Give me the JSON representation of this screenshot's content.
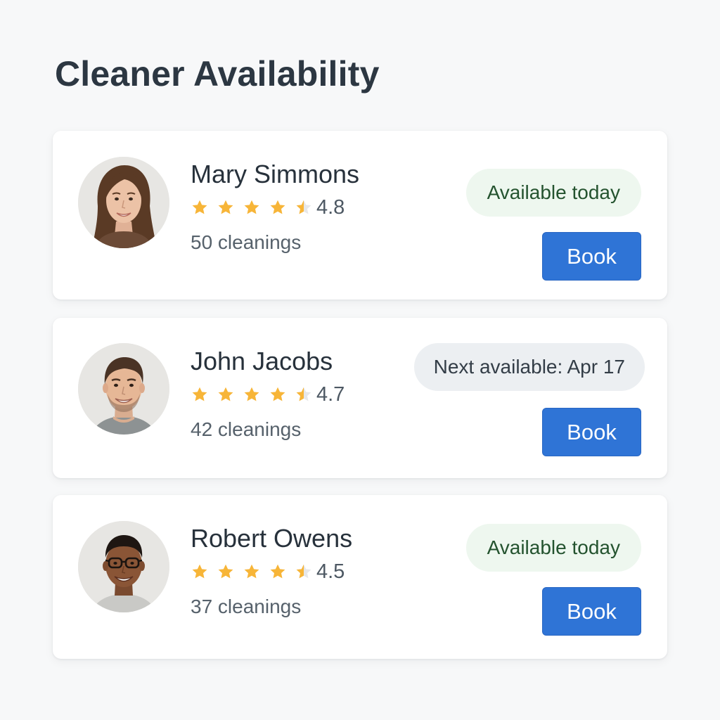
{
  "page": {
    "title": "Cleaner Availability"
  },
  "colors": {
    "star": "#f7b538",
    "star_empty": "#e6e7e9",
    "available_badge_bg": "#eef7ef",
    "available_badge_text": "#24532f",
    "next_badge_bg": "#eceff2",
    "book_button_bg": "#2f74d6"
  },
  "cleaners": [
    {
      "name": "Mary Simmons",
      "rating": "4.8",
      "stars_shown": 4.5,
      "cleanings": "50 cleanings",
      "availability": "Available today",
      "availability_status": "available",
      "book_label": "Book",
      "avatar_icon": "avatar-woman-icon"
    },
    {
      "name": "John Jacobs",
      "rating": "4.7",
      "stars_shown": 4.5,
      "cleanings": "42 cleanings",
      "availability": "Next available: Apr 17",
      "availability_status": "next",
      "book_label": "Book",
      "avatar_icon": "avatar-man-icon"
    },
    {
      "name": "Robert Owens",
      "rating": "4.5",
      "stars_shown": 4.5,
      "cleanings": "37 cleanings",
      "availability": "Available today",
      "availability_status": "available",
      "book_label": "Book",
      "avatar_icon": "avatar-man-glasses-icon"
    }
  ]
}
